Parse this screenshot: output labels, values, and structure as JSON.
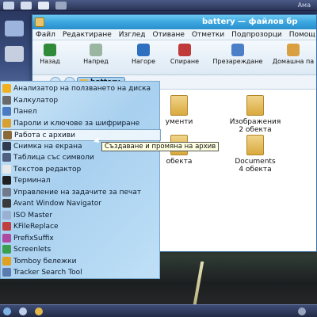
{
  "top_panel": {
    "clock": "Ама"
  },
  "window": {
    "title": "battery — файлов бр",
    "menu": [
      "Файл",
      "Редактиране",
      "Изглед",
      "Отиване",
      "Отметки",
      "Подпрозорци",
      "Помощ"
    ],
    "toolbar": [
      "Назад",
      "Напред",
      "Нагоре",
      "Спиране",
      "Презареждане",
      "Домашна па"
    ],
    "location_crumb": "battery",
    "folders": [
      {
        "name": "ументи",
        "count": ""
      },
      {
        "name": "Изображения",
        "count": "2 обекта"
      },
      {
        "name": "",
        "count": "обекта"
      },
      {
        "name": "Documents",
        "count": "4 обекта"
      }
    ]
  },
  "app_menu": {
    "items": [
      {
        "label": "Анализатор на ползването на диска",
        "icon": "disk-usage-icon",
        "color": "#f0b020"
      },
      {
        "label": "Калкулатор",
        "icon": "calculator-icon",
        "color": "#6a6a6a"
      },
      {
        "label": "Панел",
        "icon": "panel-icon",
        "color": "#4a7bc0"
      },
      {
        "label": "Пароли и ключове за шифриране",
        "icon": "key-icon",
        "color": "#d8a030"
      },
      {
        "label": "Работа с архиви",
        "icon": "archive-icon",
        "color": "#8a6a3a"
      },
      {
        "label": "Снимка на екрана",
        "icon": "camera-icon",
        "color": "#303a50"
      },
      {
        "label": "Таблица със символи",
        "icon": "charmap-icon",
        "color": "#506080"
      },
      {
        "label": "Текстов редактор",
        "icon": "text-editor-icon",
        "color": "#e8e8e8"
      },
      {
        "label": "Терминал",
        "icon": "terminal-icon",
        "color": "#202020"
      },
      {
        "label": "Управление на задачите за печат",
        "icon": "printer-icon",
        "color": "#707a8a"
      },
      {
        "label": "Avant Window Navigator",
        "icon": "awn-icon",
        "color": "#3a3a3a"
      },
      {
        "label": "ISO Master",
        "icon": "cd-icon",
        "color": "#9ab0d0"
      },
      {
        "label": "KFileReplace",
        "icon": "replace-icon",
        "color": "#c04040"
      },
      {
        "label": "PrefixSuffix",
        "icon": "prefix-icon",
        "color": "#b04aa0"
      },
      {
        "label": "Screenlets",
        "icon": "screenlets-icon",
        "color": "#3aa050"
      },
      {
        "label": "Tomboy бележки",
        "icon": "tomboy-icon",
        "color": "#e0a020"
      },
      {
        "label": "Tracker Search Tool",
        "icon": "tracker-icon",
        "color": "#5a7ab0"
      }
    ],
    "highlighted_index": 4
  },
  "tooltip": "Създаване и промяна на архив",
  "colors": {
    "titlebar": "#3ba6df",
    "menu_bg": "#a8d0ef",
    "window_border": "#3a6fa5"
  }
}
